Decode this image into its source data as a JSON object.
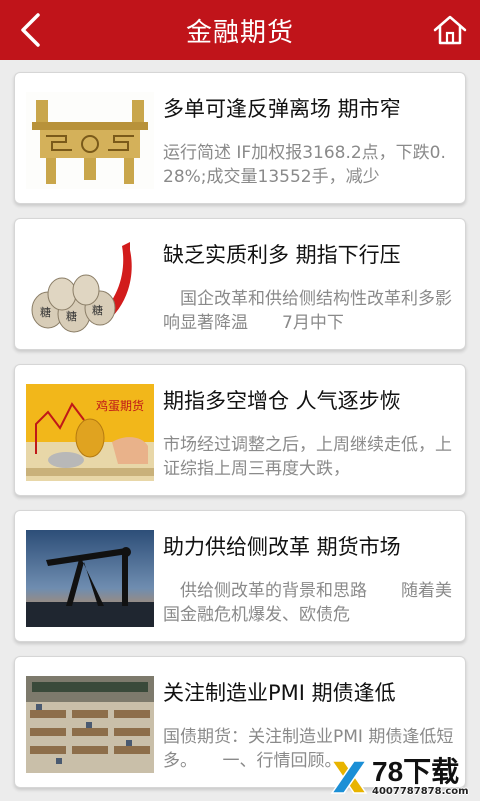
{
  "header": {
    "title": "金融期货",
    "back_icon": "chevron-left-icon",
    "home_icon": "home-icon",
    "background": "#c0141a"
  },
  "articles": [
    {
      "title": "多单可逢反弹离场 期市窄",
      "summary": "运行简述 IF加权报3168.2点，下跌0.28%;成交量13552手，减少",
      "thumbnail": "golden-ding-vessel-image"
    },
    {
      "title": "缺乏实质利多 期指下行压",
      "summary": "　国企改革和供给侧结构性改革利多影响显著降温　　7月中下",
      "thumbnail": "sugar-bags-image"
    },
    {
      "title": "期指多空增仓 人气逐步恢",
      "summary": "市场经过调整之后，上周继续走低，上证综指上周三再度大跌，",
      "thumbnail": "egg-futures-image"
    },
    {
      "title": "助力供给侧改革 期货市场",
      "summary": "　供给侧改革的背景和思路　　随着美国金融危机爆发、欧债危",
      "thumbnail": "oil-pump-image"
    },
    {
      "title": "关注制造业PMI 期债逢低",
      "summary": "国债期货：关注制造业PMI 期债逢低短多。　　一、行情回顾。",
      "thumbnail": "trading-floor-image"
    }
  ],
  "watermark": {
    "main": "78下载",
    "sub": "4007787878.com"
  }
}
